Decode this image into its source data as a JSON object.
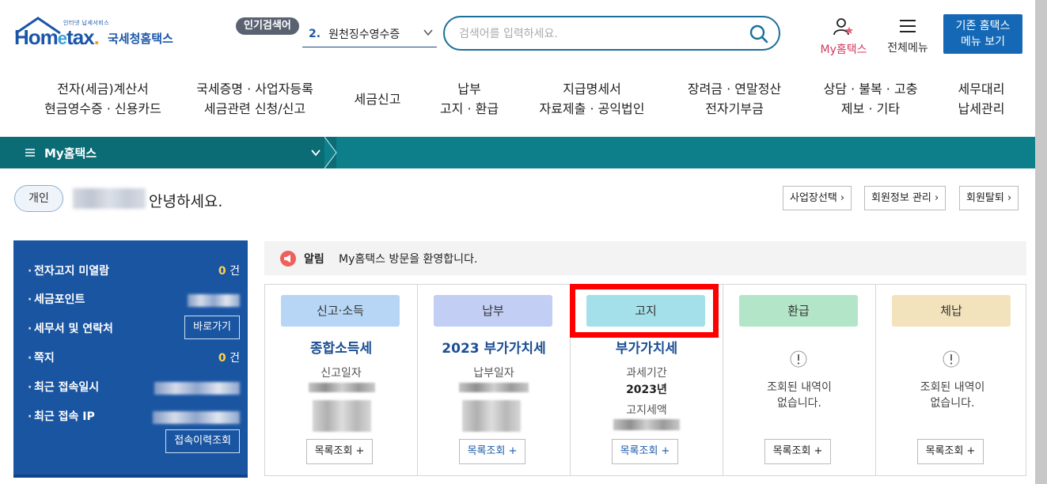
{
  "header": {
    "logo_small": "인터넷 납세서비스",
    "logo_word_a": "Hom",
    "logo_word_e": "e",
    "logo_word_b": "tax",
    "logo_dot": ".",
    "logo_kor": "국세청홈택스",
    "popular_badge": "인기검색어",
    "popular_num": "2.",
    "popular_text": "원천징수영수증",
    "search_placeholder": "검색어를 입력하세요.",
    "myhome_label": "My홈택스",
    "allmenu_label": "전체메뉴",
    "legacy_line1": "기존 홈택스",
    "legacy_line2": "메뉴 보기"
  },
  "gnb": [
    {
      "l1": "전자(세금)계산서",
      "l2": "현금영수증 · 신용카드"
    },
    {
      "l1": "국세증명 · 사업자등록",
      "l2": "세금관련 신청/신고"
    },
    {
      "l1": "세금신고",
      "l2": ""
    },
    {
      "l1": "납부",
      "l2": "고지 · 환급"
    },
    {
      "l1": "지급명세서",
      "l2": "자료제출 · 공익법인"
    },
    {
      "l1": "장려금 · 연말정산",
      "l2": "전자기부금"
    },
    {
      "l1": "상담 · 불복 · 고충",
      "l2": "제보 · 기타"
    },
    {
      "l1": "세무대리",
      "l2": "납세관리"
    }
  ],
  "mybar": {
    "title": "My홈택스"
  },
  "greeting": {
    "badge": "개인",
    "text": "안녕하세요.",
    "btn_business": "사업장선택 ›",
    "btn_member": "회원정보 관리 ›",
    "btn_leave": "회원탈퇴 ›"
  },
  "left_panel": {
    "r1_label": "전자고지 미열람",
    "r1_num": "0",
    "r1_unit": "건",
    "r2_label": "세금포인트",
    "r3_label": "세무서 및 연락처",
    "r3_btn": "바로가기",
    "r4_label": "쪽지",
    "r4_num": "0",
    "r4_unit": "건",
    "r5_label": "최근 접속일시",
    "r6_label": "최근 접속 IP",
    "history_btn": "접속이력조회"
  },
  "notice": {
    "tag": "알림",
    "message": "My홈택스 방문을 환영합니다."
  },
  "cards": [
    {
      "category": "신고·소득",
      "title": "종합소득세",
      "sub1": "신고일자",
      "button": "목록조회 +"
    },
    {
      "category": "납부",
      "title": "2023 부가가치세",
      "sub1": "납부일자",
      "button": "목록조회 +"
    },
    {
      "category": "고지",
      "title": "부가가치세",
      "sub1": "과세기간",
      "sub1_value": "2023년",
      "sub2": "고지세액",
      "button": "목록조회 +"
    },
    {
      "category": "환급",
      "empty1": "조회된 내역이",
      "empty2": "없습니다.",
      "button": "목록조회 +"
    },
    {
      "category": "체납",
      "empty1": "조회된 내역이",
      "empty2": "없습니다.",
      "button": "목록조회 +"
    }
  ],
  "colors": {
    "brand": "#1a56a8",
    "mybar": "#0d7f8a",
    "left_panel": "#1a55a2",
    "cat_income": "#b7d6f5",
    "cat_pay": "#c2cef3",
    "cat_notice": "#a4e0ea",
    "cat_refund": "#b3e6c8",
    "cat_arrears": "#f2e3bd",
    "highlight": "#ff0000"
  }
}
